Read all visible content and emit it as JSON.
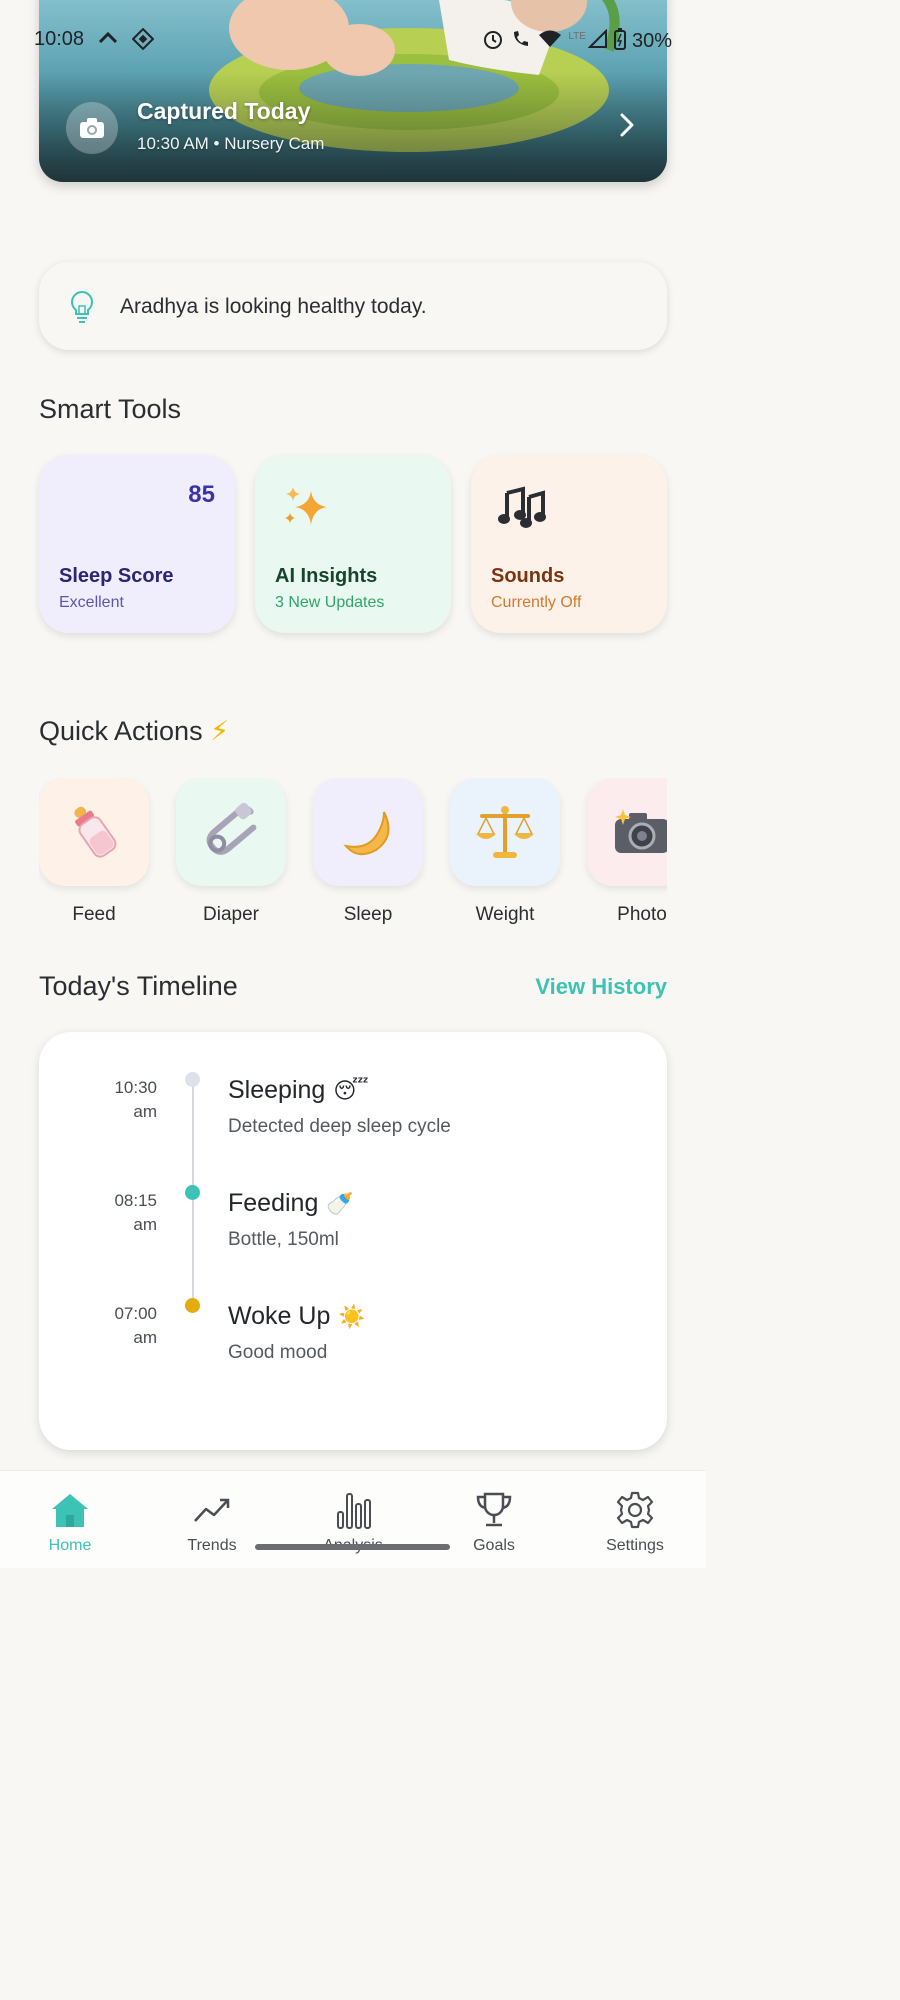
{
  "status_bar": {
    "time": "10:08",
    "battery": "30%",
    "network": "LTE"
  },
  "hero": {
    "title": "Captured Today",
    "subtitle": "10:30 AM • Nursery Cam",
    "icon": "camera-icon",
    "arrow_icon": "chevron-right-icon"
  },
  "banner": {
    "icon": "lightbulb-icon",
    "message": "Aradhya is looking healthy today."
  },
  "smart_tools": {
    "heading": "Smart Tools",
    "items": [
      {
        "title": "Sleep Score",
        "subtitle": "Excellent",
        "value": "85",
        "bg": "#f0eefc",
        "title_color": "#2a2676",
        "sub_color": "#5a55b5"
      },
      {
        "title": "AI Insights",
        "subtitle": "3 New Updates",
        "icon": "sparkles-icon",
        "bg": "#e9f8f0",
        "title_color": "#17452b",
        "sub_color": "#2fa56a"
      },
      {
        "title": "Sounds",
        "subtitle": "Currently Off",
        "icon": "music-notes-icon",
        "bg": "#fdf2e9",
        "title_color": "#7a3410",
        "sub_color": "#d07a2e"
      }
    ]
  },
  "quick_actions": {
    "heading": "Quick Actions",
    "heading_emoji": "⚡",
    "items": [
      {
        "label": "Feed",
        "icon": "baby-bottle-icon",
        "bg": "#fdf1e8"
      },
      {
        "label": "Diaper",
        "icon": "safety-pin-icon",
        "bg": "#e9f8f0"
      },
      {
        "label": "Sleep",
        "icon": "crescent-moon-icon",
        "bg": "#f0eefc"
      },
      {
        "label": "Weight",
        "icon": "balance-scale-icon",
        "bg": "#eaf2fc"
      },
      {
        "label": "Photo",
        "icon": "camera-flash-icon",
        "bg": "#fdecee"
      }
    ]
  },
  "timeline": {
    "heading": "Today's Timeline",
    "view_history": "View History",
    "items": [
      {
        "time": "10:30",
        "ampm": "am",
        "title": "Sleeping",
        "emoji": "😴",
        "desc": "Detected deep sleep cycle",
        "dot": "#dde1ea"
      },
      {
        "time": "08:15",
        "ampm": "am",
        "title": "Feeding",
        "emoji": "🍼",
        "desc": "Bottle, 150ml",
        "dot": "#3cc3b5"
      },
      {
        "time": "07:00",
        "ampm": "am",
        "title": "Woke Up",
        "emoji": "☀️",
        "desc": "Good mood",
        "dot": "#e3ad12"
      }
    ]
  },
  "nav": {
    "items": [
      {
        "label": "Home",
        "icon": "home-icon",
        "active": true
      },
      {
        "label": "Trends",
        "icon": "trend-line-icon"
      },
      {
        "label": "Analysis",
        "icon": "bar-chart-icon"
      },
      {
        "label": "Goals",
        "icon": "trophy-icon"
      },
      {
        "label": "Settings",
        "icon": "gear-icon"
      }
    ]
  },
  "colors": {
    "accent": "#3cc3b5",
    "background": "#f8f7f3"
  }
}
